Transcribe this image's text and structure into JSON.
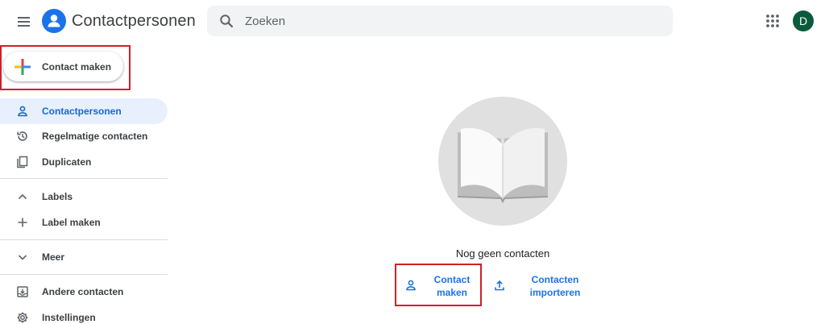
{
  "header": {
    "app_title": "Contactpersonen",
    "search_placeholder": "Zoeken",
    "avatar_initial": "D",
    "logo_color": "#1a73e8",
    "avatar_color": "#0b5b3a"
  },
  "create_button": {
    "label": "Contact maken"
  },
  "sidebar": {
    "items": [
      {
        "label": "Contactpersonen",
        "icon": "person-icon",
        "active": true
      },
      {
        "label": "Regelmatige contacten",
        "icon": "history-icon"
      },
      {
        "label": "Duplicaten",
        "icon": "copy-icon"
      },
      {
        "label": "Labels",
        "icon": "chevron-up-icon"
      },
      {
        "label": "Label maken",
        "icon": "plus-icon"
      },
      {
        "label": "Meer",
        "icon": "chevron-down-icon"
      },
      {
        "label": "Andere contacten",
        "icon": "inbox-download-icon"
      },
      {
        "label": "Instellingen",
        "icon": "gear-icon"
      }
    ]
  },
  "main": {
    "empty_title": "Nog geen contacten",
    "create_action_line1": "Contact",
    "create_action_line2": "maken",
    "import_action_line1": "Contacten",
    "import_action_line2": "importeren"
  },
  "colors": {
    "accent": "#1a73e8",
    "active_bg": "#e8f0fe",
    "highlight": "#d0202a"
  }
}
